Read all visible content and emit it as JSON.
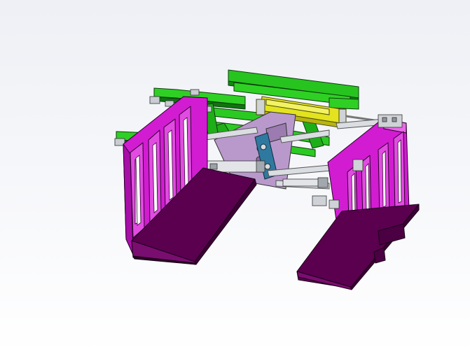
{
  "scene": {
    "subject": "gripper-assembly",
    "colors": {
      "background_top": "#f3f4f8",
      "background_bottom": "#ffffff",
      "frame_green": "#22c11b",
      "frame_green_dark": "#0f6b10",
      "rail_green": "#2fd024",
      "side_plate_magenta": "#d018d0",
      "side_plate_light": "#e24be2",
      "jaw_purple": "#5a004f",
      "jaw_purple_side": "#7a0d70",
      "cylinder_yellow": "#e3e31f",
      "bracket_lavender": "#b294c6",
      "link_blue": "#2c6f8f",
      "rod_grey": "#d4d7db",
      "outline": "#1c1c1c"
    }
  }
}
